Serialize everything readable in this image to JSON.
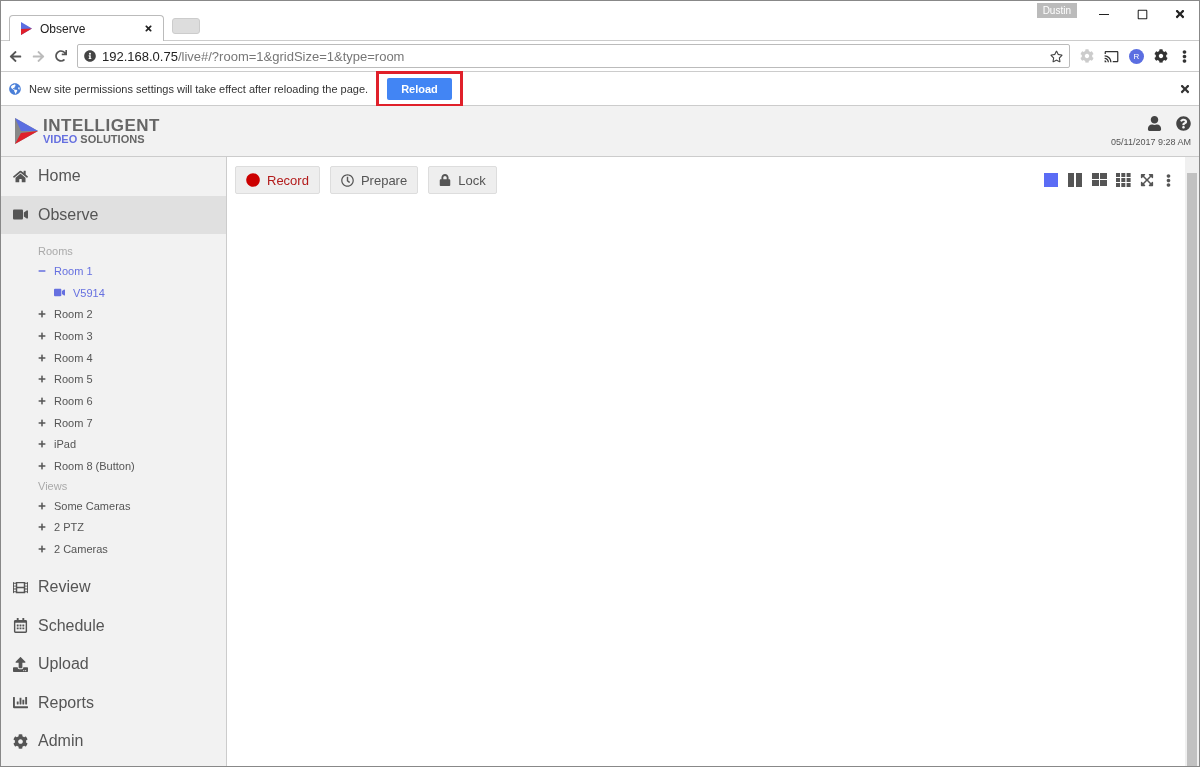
{
  "browser": {
    "tab_title": "Observe",
    "profile": "Dustin",
    "url_host": "192.168.0.75",
    "url_path": "/live#/?room=1&gridSize=1&type=room",
    "extension_letter": "R"
  },
  "infobar": {
    "message": "New site permissions settings will take effect after reloading the page.",
    "button": "Reload",
    "highlighted": true
  },
  "header": {
    "logo_top": "INTELLIGENT",
    "logo_accent": "VIDEO",
    "logo_rest": "SOLUTIONS",
    "datetime": "05/11/2017 9:28 AM"
  },
  "sidebar": {
    "items": [
      {
        "label": "Home",
        "selected": false
      },
      {
        "label": "Observe",
        "selected": true,
        "sections": [
          {
            "title": "Rooms",
            "items": [
              {
                "label": "Room 1",
                "expanded": true,
                "selected": true,
                "children": [
                  {
                    "label": "V5914",
                    "selected": true
                  }
                ]
              },
              {
                "label": "Room 2",
                "expanded": false,
                "selected": false
              },
              {
                "label": "Room 3",
                "expanded": false,
                "selected": false
              },
              {
                "label": "Room 4",
                "expanded": false,
                "selected": false
              },
              {
                "label": "Room 5",
                "expanded": false,
                "selected": false
              },
              {
                "label": "Room 6",
                "expanded": false,
                "selected": false
              },
              {
                "label": "Room 7",
                "expanded": false,
                "selected": false
              },
              {
                "label": "iPad",
                "expanded": false,
                "selected": false
              },
              {
                "label": "Room 8 (Button)",
                "expanded": false,
                "selected": false
              }
            ]
          },
          {
            "title": "Views",
            "items": [
              {
                "label": "Some Cameras",
                "expanded": false,
                "selected": false
              },
              {
                "label": "2 PTZ",
                "expanded": false,
                "selected": false
              },
              {
                "label": "2 Cameras",
                "expanded": false,
                "selected": false
              }
            ]
          }
        ]
      },
      {
        "label": "Review",
        "selected": false
      },
      {
        "label": "Schedule",
        "selected": false
      },
      {
        "label": "Upload",
        "selected": false
      },
      {
        "label": "Reports",
        "selected": false
      },
      {
        "label": "Admin",
        "selected": false
      }
    ]
  },
  "toolbar": {
    "buttons": [
      {
        "label": "Record",
        "kind": "record"
      },
      {
        "label": "Prepare",
        "kind": "prepare"
      },
      {
        "label": "Lock",
        "kind": "lock"
      }
    ],
    "layouts": [
      {
        "kind": "single",
        "selected": true
      },
      {
        "kind": "double",
        "selected": false
      },
      {
        "kind": "quad",
        "selected": false
      },
      {
        "kind": "nine",
        "selected": false
      }
    ]
  }
}
